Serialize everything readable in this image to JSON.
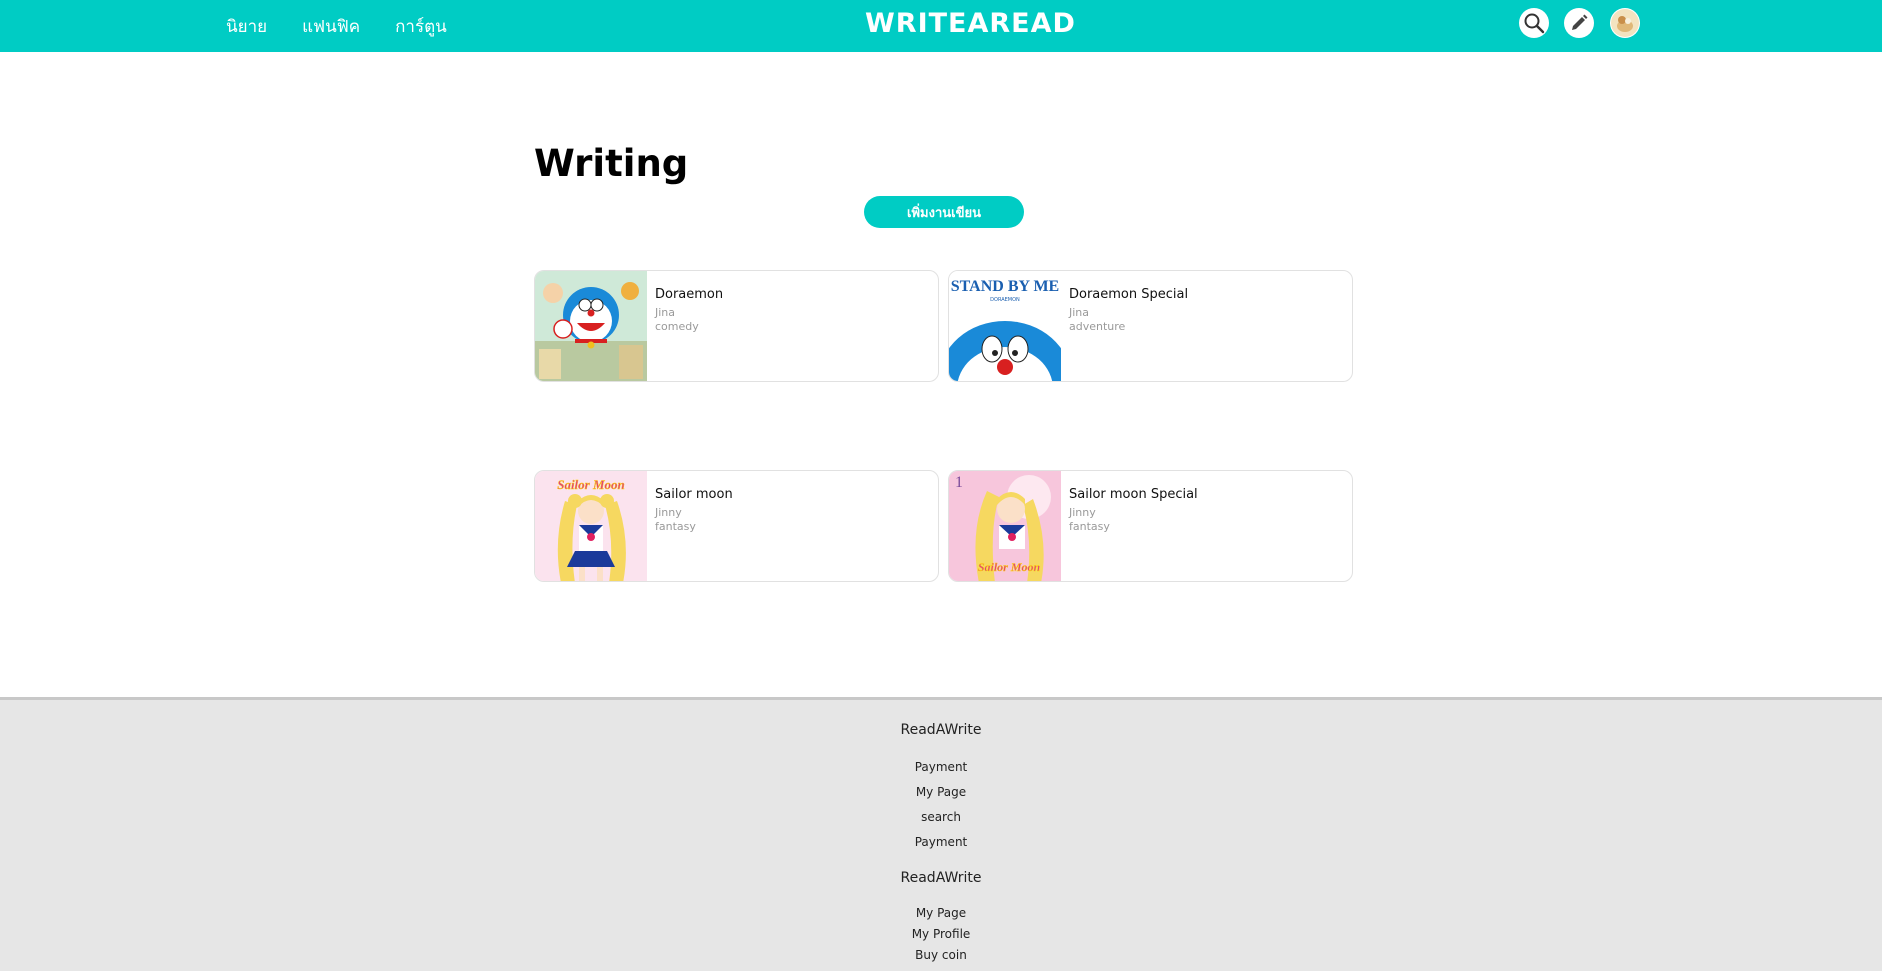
{
  "header": {
    "nav": [
      "นิยาย",
      "แฟนฟิค",
      "การ์ตูน"
    ],
    "logo": "WRITEAREAD",
    "icons": [
      "search-icon",
      "pencil-icon",
      "avatar"
    ],
    "brand_color": "#00ccc4"
  },
  "main": {
    "title": "Writing",
    "add_button": "เพิ่มงานเขียน",
    "works": [
      {
        "title": "Doraemon",
        "author": "Jina",
        "genre": "comedy"
      },
      {
        "title": "Doraemon Special",
        "author": "Jina",
        "genre": "adventure",
        "cover_text": "STAND BY ME",
        "cover_subtext": "DORAEMON"
      },
      {
        "title": "Sailor moon",
        "author": "Jinny",
        "genre": "fantasy",
        "cover_text": "Sailor Moon"
      },
      {
        "title": "Sailor moon Special",
        "author": "Jinny",
        "genre": "fantasy",
        "cover_text": "Sailor Moon"
      }
    ]
  },
  "footer": {
    "heading_1": "ReadAWrite",
    "links_1": [
      "Payment",
      "My Page",
      "search",
      "Payment"
    ],
    "heading_2": "ReadAWrite",
    "links_2": [
      "My Page",
      "My Profile",
      "Buy coin"
    ]
  }
}
